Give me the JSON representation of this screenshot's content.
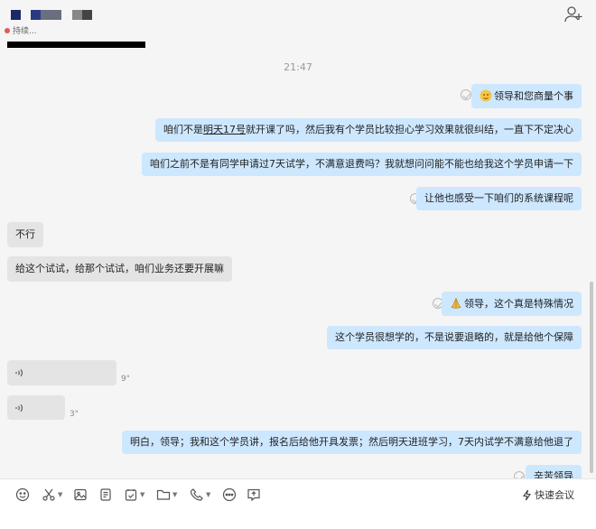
{
  "header": {
    "status_text": "持续...",
    "add_member_icon": "add-member-icon"
  },
  "timestamp": "21:47",
  "messages": [
    {
      "side": "out",
      "text": "领导和您商量个事",
      "emoji": "sweat-smile"
    },
    {
      "side": "out",
      "pre": "咱们不是",
      "underline": "明天17号",
      "post": "就开课了吗，然后我有个学员比较担心学习效果就很纠结，一直下不定决心"
    },
    {
      "side": "out",
      "text": "咱们之前不是有同学申请过7天试学，不满意退费吗？我就想问问能不能也给我这个学员申请一下"
    },
    {
      "side": "out",
      "text": "让他也感受一下咱们的系统课程呢"
    },
    {
      "side": "in",
      "text": "不行"
    },
    {
      "side": "in",
      "text": "给这个试试，给那个试试，咱们业务还要开展嘛"
    },
    {
      "side": "out",
      "text": "领导，这个真是特殊情况",
      "emoji": "praying-hands"
    },
    {
      "side": "out",
      "text": "这个学员很想学的，不是说要退略的，就是给他个保障"
    },
    {
      "side": "in",
      "type": "voice",
      "duration": "9\""
    },
    {
      "side": "in",
      "type": "voice",
      "duration": "3\""
    },
    {
      "side": "out",
      "text": "明白，领导；我和这个学员讲，报名后给他开具发票；然后明天进班学习，7天内试学不满意给他退了"
    },
    {
      "side": "out",
      "text": "辛苦领导"
    }
  ],
  "toolbar": {
    "items": [
      "emoji-icon",
      "scissors-icon",
      "image-icon",
      "document-icon",
      "task-icon",
      "folder-icon",
      "phone-icon",
      "more-icon",
      "screen-share-icon"
    ],
    "quick_meeting_label": "快速会议"
  },
  "colors": {
    "outgoing_bubble": "#cde7ff",
    "incoming_bubble": "#e4e4e4",
    "background": "#f5f5f5"
  }
}
